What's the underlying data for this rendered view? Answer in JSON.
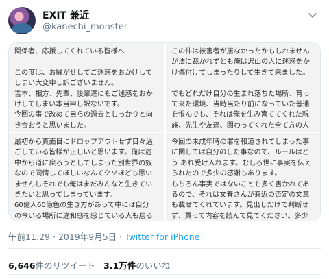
{
  "tweet": {
    "display_name": "EXIT 兼近",
    "handle": "@kanechi_monster",
    "caret_icon": "chevron-down-icon",
    "image_panels": {
      "top_left": "関係者、応援してくれている皆様へ\n\nこの度は、お騒がせしてご迷惑をおかけして\nしまい大変申し訳ございません。\n吉本、相方、先輩、後輩達にもご迷惑をおか\nけしてしまい本当申し訳ないです。\n今回の事で改めて自らの過去としっかりと向\nき合おうと思いました。",
      "top_right": "この件は被害者が居なかったかもしれません\nが法に裁かれずとも俺は沢山の人に迷惑をか\nけ傷付けてしまったりして生きて来ました。\n\nでもどれだけ自分の生まれ落ちた場所、育っ\nて来た環境、当時当たり前になっていた普通\nを恨んでも、それは俺を生み育ててくれた親\n族、先生や友達、関わってくれた全て方の人\nを否定する事になって、",
      "bottom_left": "最初から真面目にドロップアウトせず日々過\nごしている皆様が正しいと思います。俺は途\n中から道に戻ろうとしてしまった別世界の奴\nなので同情してほしいなんてクソほども思い\nませんしそれでも俺はまだみんなと生きてい\nきたいと思ってしまっています。\n60億人60億色の生き方があって中には自分\nの今いる場所に違和感を感じている人も居る",
      "bottom_right": "今回の未成年時の罪を報道されてしまった事\nに関しては自分のした事なので、ルールはど\nう あれ受け入れます。むしろ世に事実を伝え\nられたので多少の感謝もあります。\nもちろん事実ではないことも多く書かれてあ\nるので、それは文春さんが兼近の否定の文章\nも載せてくれています。見出しだけで判断せ\nず、買って内容を読んで見てください。多少"
    },
    "timestamp": "午前11:29 · 2019年9月5日",
    "source": "Twitter for iPhone",
    "retweet_count": "6,646",
    "retweet_label": "件のリツイート",
    "like_count": "3.1万件",
    "like_label": "のいいね"
  }
}
